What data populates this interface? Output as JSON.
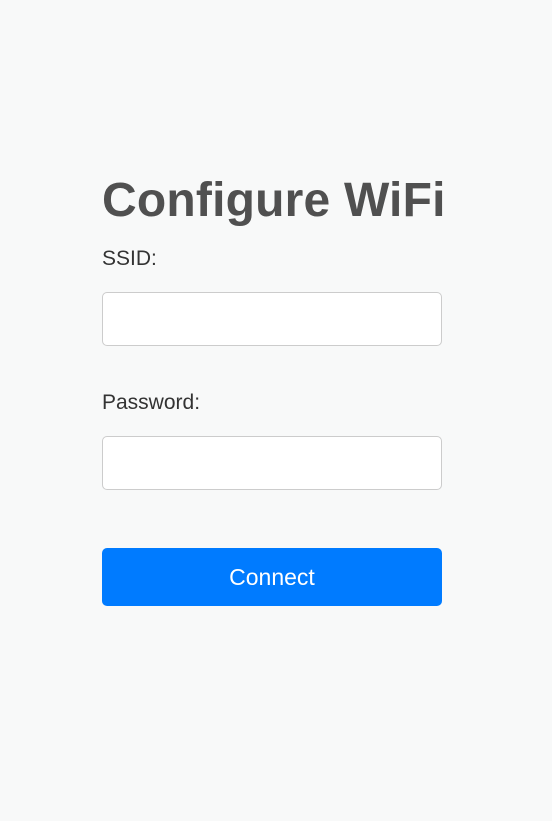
{
  "form": {
    "title": "Configure WiFi",
    "ssid_label": "SSID:",
    "ssid_value": "",
    "password_label": "Password:",
    "password_value": "",
    "connect_label": "Connect"
  },
  "colors": {
    "background": "#f8f9f9",
    "title": "#505050",
    "label": "#333333",
    "input_border": "#cccccc",
    "button_bg": "#007bff",
    "button_text": "#ffffff"
  }
}
